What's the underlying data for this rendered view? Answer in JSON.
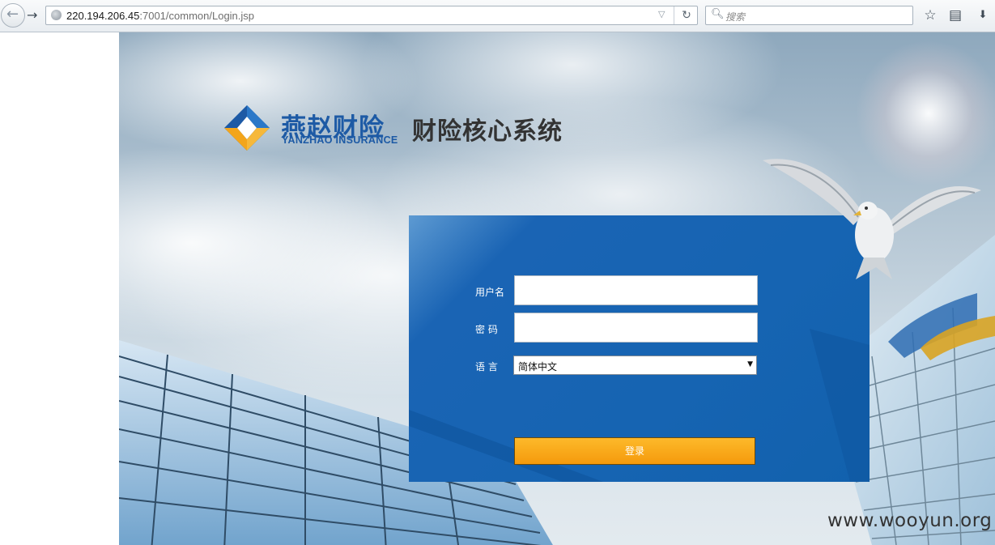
{
  "browser": {
    "url_host": "220.194.206.45",
    "url_path": ":7001/common/Login.jsp",
    "search_placeholder": "搜索"
  },
  "brand": {
    "name_cn": "燕赵财险",
    "name_en": "YANZHAO INSURANCE",
    "system_title": "财险核心系统"
  },
  "login": {
    "username_label": "用户名",
    "password_label": "密 码",
    "language_label": "语 言",
    "language_selected": "简体中文",
    "submit_label": "登录"
  },
  "watermark": "www.wooyun.org",
  "colors": {
    "panel_blue": "#1664b2",
    "button_orange": "#f8a81a",
    "brand_blue": "#1d5aa5"
  }
}
